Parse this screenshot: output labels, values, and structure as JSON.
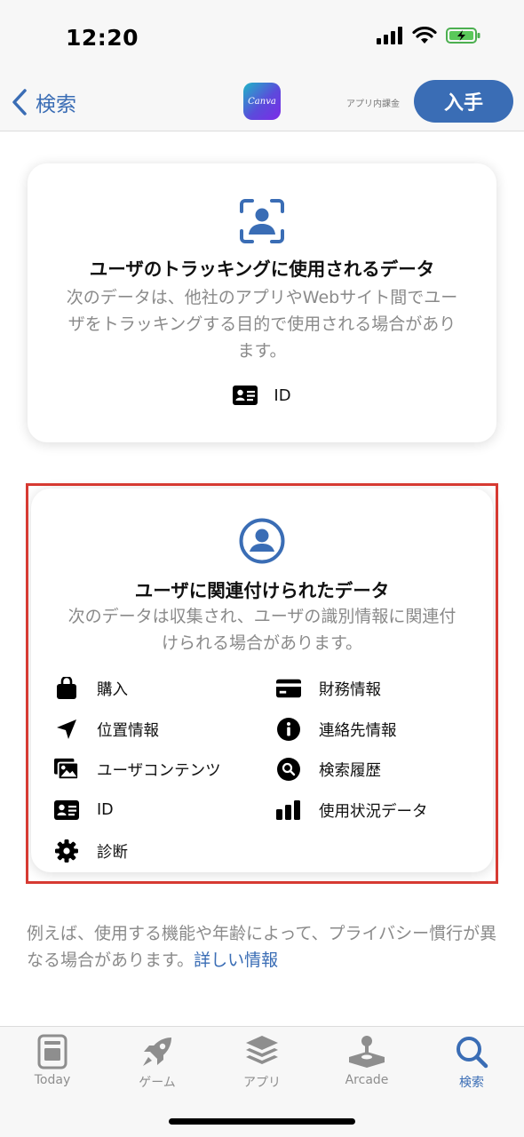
{
  "status": {
    "time": "12:20"
  },
  "nav": {
    "back_label": "検索",
    "app_icon_text": "Canva",
    "iap_label": "アプリ内課金",
    "get_label": "入手"
  },
  "tracking": {
    "title": "ユーザのトラッキングに使用されるデータ",
    "desc": "次のデータは、他社のアプリやWebサイト間でユーザをトラッキングする目的で使用される場合があります。",
    "items": [
      {
        "label": "ID",
        "icon": "id-card-icon"
      }
    ]
  },
  "linked": {
    "title": "ユーザに関連付けられたデータ",
    "desc": "次のデータは収集され、ユーザの識別情報に関連付けられる場合があります。",
    "items": [
      {
        "label": "購入",
        "icon": "shopping-bag-icon"
      },
      {
        "label": "財務情報",
        "icon": "credit-card-icon"
      },
      {
        "label": "位置情報",
        "icon": "location-arrow-icon"
      },
      {
        "label": "連絡先情報",
        "icon": "info-icon"
      },
      {
        "label": "ユーザコンテンツ",
        "icon": "photos-icon"
      },
      {
        "label": "検索履歴",
        "icon": "search-icon"
      },
      {
        "label": "ID",
        "icon": "id-card-icon"
      },
      {
        "label": "使用状況データ",
        "icon": "bar-chart-icon"
      },
      {
        "label": "診断",
        "icon": "gear-icon"
      }
    ]
  },
  "footnote": {
    "text": "例えば、使用する機能や年齢によって、プライバシー慣行が異なる場合があります。",
    "link": "詳しい情報"
  },
  "tabs": [
    {
      "label": "Today",
      "icon": "today-icon"
    },
    {
      "label": "ゲーム",
      "icon": "rocket-icon"
    },
    {
      "label": "アプリ",
      "icon": "layers-icon"
    },
    {
      "label": "Arcade",
      "icon": "joystick-icon"
    },
    {
      "label": "検索",
      "icon": "search-icon"
    }
  ],
  "colors": {
    "accent": "#3a6db5",
    "highlight": "#d63a32"
  }
}
